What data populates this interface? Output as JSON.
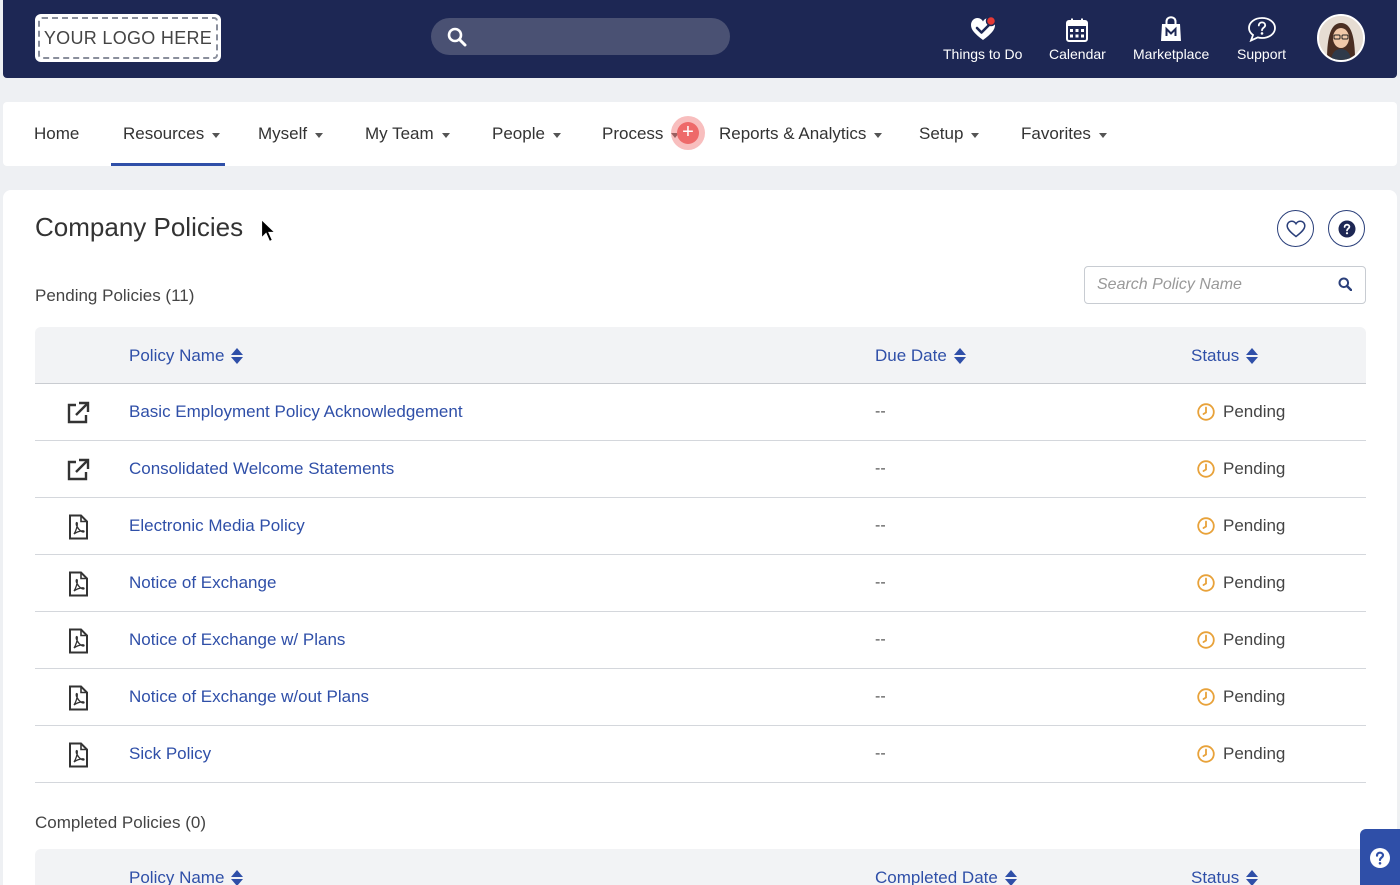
{
  "header": {
    "logo_text": "YOUR LOGO HERE",
    "search_placeholder": "",
    "nav": [
      {
        "label": "Things to Do",
        "icon": "checkmark-heart-icon"
      },
      {
        "label": "Calendar",
        "icon": "calendar-icon"
      },
      {
        "label": "Marketplace",
        "icon": "shopping-bag-icon"
      },
      {
        "label": "Support",
        "icon": "question-bubble-icon"
      }
    ],
    "colors": {
      "header_bg": "#1d2754",
      "accent": "#2f4fa8",
      "notification": "#e53935",
      "pending": "#e8a23a"
    }
  },
  "navbar": {
    "items": [
      {
        "label": "Home"
      },
      {
        "label": "Resources"
      },
      {
        "label": "Myself"
      },
      {
        "label": "My Team"
      },
      {
        "label": "People"
      },
      {
        "label": "Process"
      },
      {
        "label": "Reports & Analytics"
      },
      {
        "label": "Setup"
      },
      {
        "label": "Favorites"
      }
    ],
    "active": "Resources",
    "plus_symbol": "+"
  },
  "page": {
    "title": "Company Policies",
    "search_placeholder": "Search Policy Name",
    "pending_label": "Pending Policies (11)",
    "completed_label": "Completed Policies (0)"
  },
  "pending_table": {
    "columns": [
      "Policy Name",
      "Due Date",
      "Status"
    ],
    "rows": [
      {
        "icon": "external-link-icon",
        "name": "Basic Employment Policy Acknowledgement",
        "due": "--",
        "status": "Pending"
      },
      {
        "icon": "external-link-icon",
        "name": "Consolidated Welcome Statements",
        "due": "--",
        "status": "Pending"
      },
      {
        "icon": "pdf-file-icon",
        "name": "Electronic Media Policy",
        "due": "--",
        "status": "Pending"
      },
      {
        "icon": "pdf-file-icon",
        "name": "Notice of Exchange",
        "due": "--",
        "status": "Pending"
      },
      {
        "icon": "pdf-file-icon",
        "name": "Notice of Exchange w/ Plans",
        "due": "--",
        "status": "Pending"
      },
      {
        "icon": "pdf-file-icon",
        "name": "Notice of Exchange w/out Plans",
        "due": "--",
        "status": "Pending"
      },
      {
        "icon": "pdf-file-icon",
        "name": "Sick Policy",
        "due": "--",
        "status": "Pending"
      }
    ]
  },
  "completed_table": {
    "columns": [
      "Policy Name",
      "Completed Date",
      "Status"
    ]
  }
}
